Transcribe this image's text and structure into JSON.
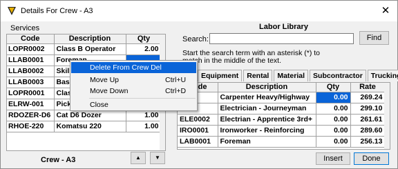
{
  "window": {
    "title": "Details For Crew - A3",
    "icon": "crew-app-icon",
    "close_glyph": "✕"
  },
  "left": {
    "section_label": "Services",
    "columns": [
      "Code",
      "Description",
      "Qty"
    ],
    "rows": [
      {
        "code": "LOPR0002",
        "description": "Class B Operator",
        "qty": "2.00"
      },
      {
        "code": "LLAB0001",
        "description": "Foreman",
        "qty": ""
      },
      {
        "code": "LLAB0002",
        "description": "Skill",
        "qty": ""
      },
      {
        "code": "LLAB0003",
        "description": "Basic",
        "qty": ""
      },
      {
        "code": "LOPR0001",
        "description": "Clas",
        "qty": ""
      },
      {
        "code": "ELRW-001",
        "description": "Pick",
        "qty": ""
      },
      {
        "code": "RDOZER-D6",
        "description": "Cat D6 Dozer",
        "qty": "1.00"
      },
      {
        "code": "RHOE-220",
        "description": "Komatsu 220",
        "qty": "1.00"
      }
    ],
    "crew_label": "Crew - A3",
    "up_glyph": "▲",
    "down_glyph": "▼"
  },
  "context_menu": {
    "items": [
      {
        "label": "Delete From Crew Del",
        "shortcut": ""
      },
      {
        "label": "Move Up",
        "shortcut": "Ctrl+U"
      },
      {
        "label": "Move Down",
        "shortcut": "Ctrl+D"
      },
      {
        "label": "Close",
        "shortcut": ""
      }
    ]
  },
  "right": {
    "title": "Labor Library",
    "search_label": "Search:",
    "search_value": "",
    "find_label": "Find",
    "hint": "Start the search term with an asterisk (*) to match in the middle of the text.",
    "tabs": [
      "Equipment",
      "Rental",
      "Material",
      "Subcontractor",
      "Trucking"
    ],
    "columns": [
      "Code",
      "Description",
      "Qty",
      "Rate"
    ],
    "rows": [
      {
        "code": "0001",
        "description": "Carpenter Heavy/Highway",
        "qty": "0.00",
        "rate": "269.24"
      },
      {
        "code": "0001",
        "description": "Electrician - Journeyman",
        "qty": "0.00",
        "rate": "299.10"
      },
      {
        "code": "ELE0002",
        "description": "Electrian - Apprentice 3rd+",
        "qty": "0.00",
        "rate": "261.61"
      },
      {
        "code": "IRO0001",
        "description": "Ironworker - Reinforcing",
        "qty": "0.00",
        "rate": "289.60"
      },
      {
        "code": "LAB0001",
        "description": "Foreman",
        "qty": "0.00",
        "rate": "256.13"
      }
    ],
    "insert_label": "Insert",
    "done_label": "Done"
  },
  "colors": {
    "selection": "#0a64d8",
    "window_bg": "#f0f0f0"
  }
}
